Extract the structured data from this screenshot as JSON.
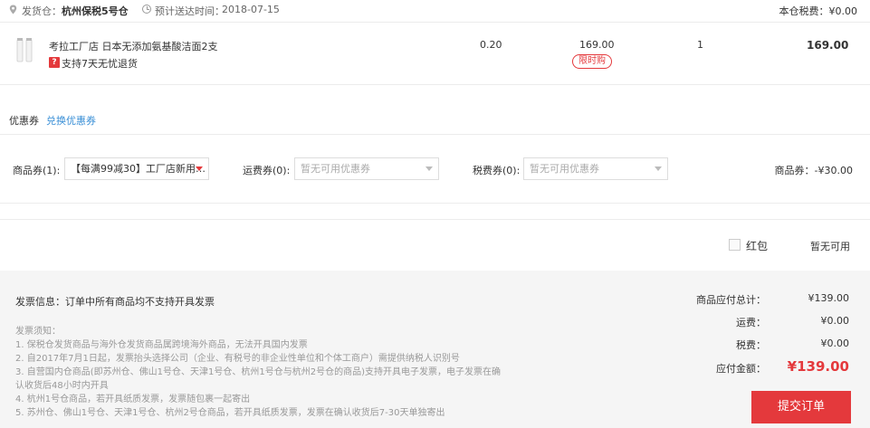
{
  "header": {
    "warehouse_label": "发货仓：",
    "warehouse": "杭州保税5号仓",
    "delivery_label": "预计送达时间：",
    "delivery_date": "2018-07-15",
    "tax_label": "本仓税费：",
    "tax_value": "¥0.00"
  },
  "product": {
    "name": "考拉工厂店 日本无添加氨基酸洁面2支",
    "return_badge": "?",
    "return_text": "支持7天无忧退货",
    "tax_rate": "0.20",
    "unit_price": "169.00",
    "limit_tag": "限时购",
    "quantity": "1",
    "subtotal": "169.00"
  },
  "coupons": {
    "title": "优惠券",
    "exchange_link": "兑换优惠券",
    "goods_label": "商品券(1):",
    "goods_value": "【每满99减30】工厂店新用…",
    "shipping_label": "运费券(0):",
    "shipping_placeholder": "暂无可用优惠券",
    "tax_label": "税费券(0):",
    "tax_placeholder": "暂无可用优惠券",
    "goods_discount": "商品券：-¥30.00"
  },
  "redpacket": {
    "label": "红包",
    "status": "暂无可用"
  },
  "invoice": {
    "title": "发票信息：订单中所有商品均不支持开具发票",
    "notes_title": "发票须知：",
    "notes": [
      "1. 保税仓发货商品与海外仓发货商品属跨境海外商品，无法开具国内发票",
      "2. 自2017年7月1日起，发票抬头选择公司（企业、有税号的非企业性单位和个体工商户）需提供纳税人识别号",
      "3. 自营国内仓商品(即苏州仓、佛山1号仓、天津1号仓、杭州1号仓与杭州2号仓的商品)支持开具电子发票，电子发票在确",
      "认收货后48小时内开具",
      "4. 杭州1号仓商品，若开具纸质发票，发票随包裹一起寄出",
      "5. 苏州仓、佛山1号仓、天津1号仓、杭州2号仓商品，若开具纸质发票，发票在确认收货后7-30天单独寄出"
    ]
  },
  "summary": {
    "goods_total_label": "商品应付总计：",
    "goods_total": "¥139.00",
    "shipping_label": "运费：",
    "shipping": "¥0.00",
    "tax_label": "税费：",
    "tax": "¥0.00",
    "payable_label": "应付金额：",
    "payable": "¥139.00",
    "submit_label": "提交订单"
  }
}
